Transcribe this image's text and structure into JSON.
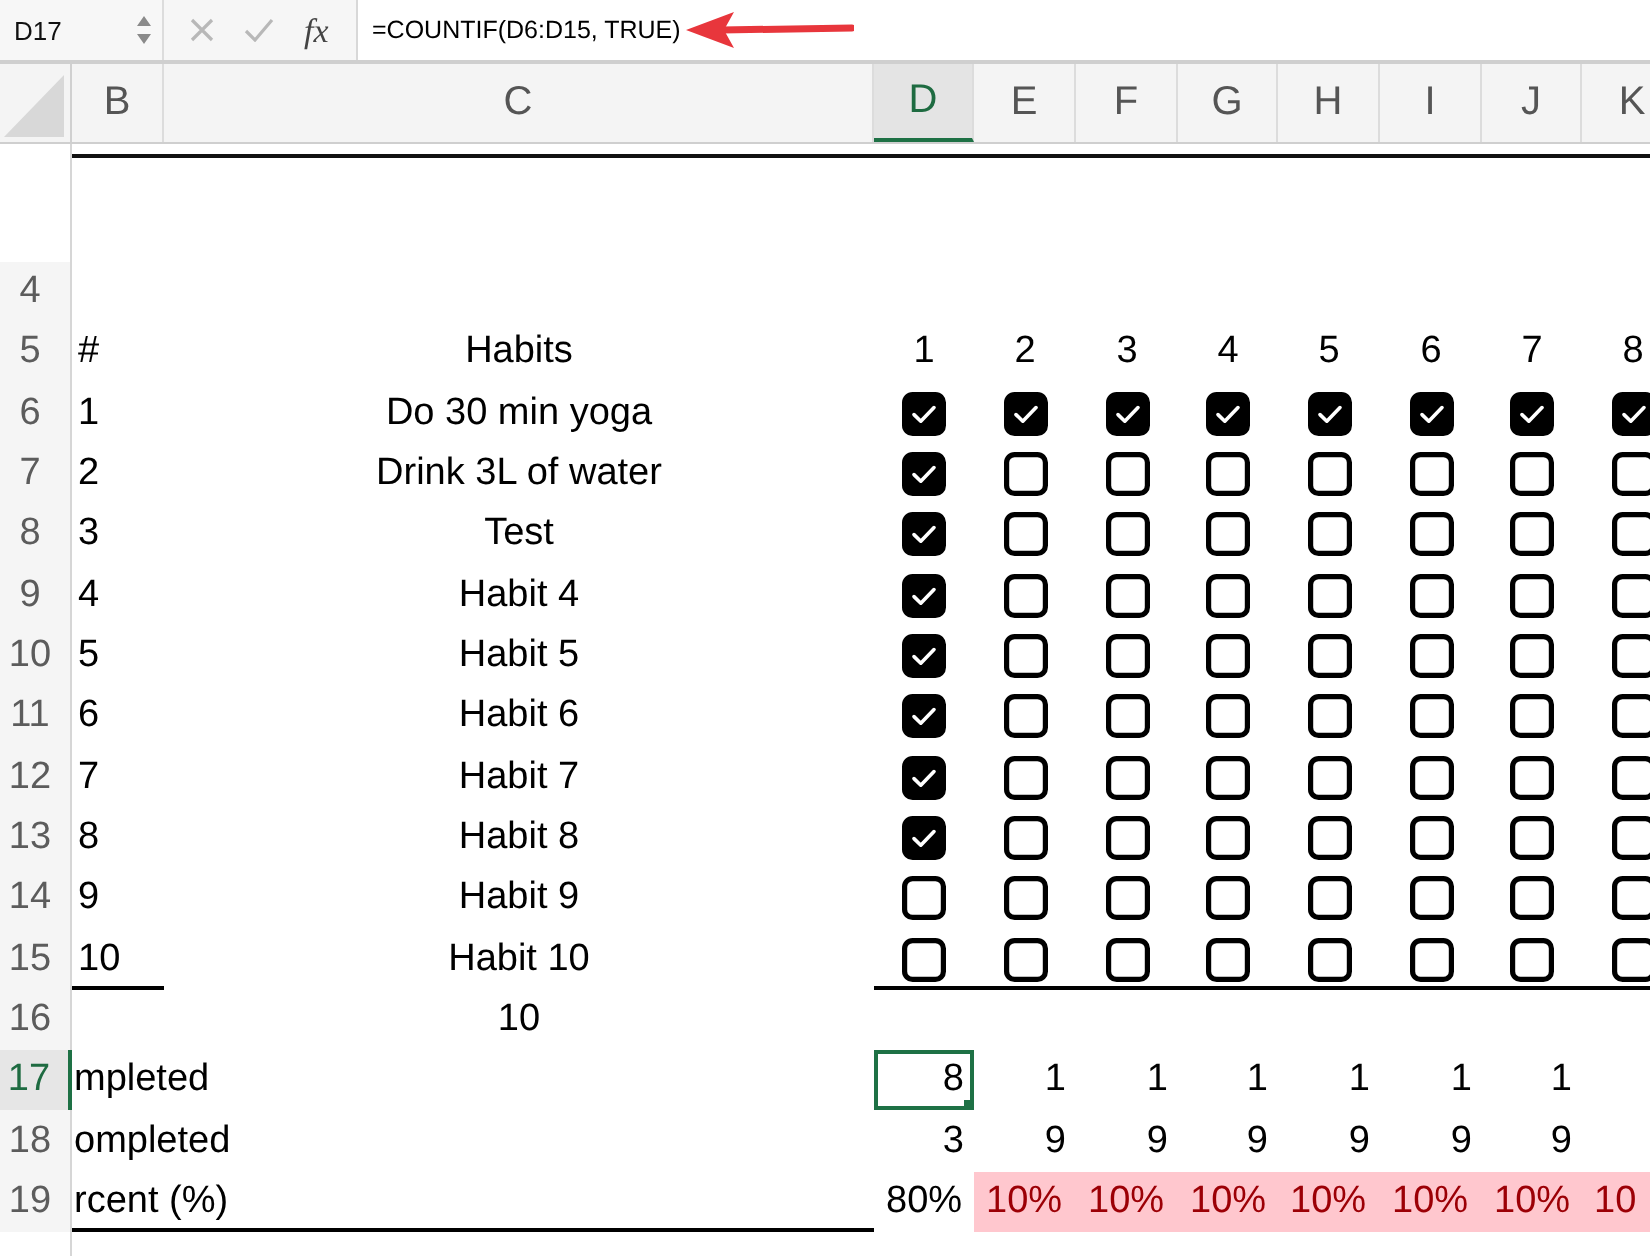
{
  "formula_bar": {
    "name_box": "D17",
    "function_label": "fx",
    "formula": "=COUNTIF(D6:D15, TRUE)"
  },
  "columns": [
    {
      "label": "B",
      "selected": false
    },
    {
      "label": "C",
      "selected": false
    },
    {
      "label": "D",
      "selected": true
    },
    {
      "label": "E",
      "selected": false
    },
    {
      "label": "F",
      "selected": false
    },
    {
      "label": "G",
      "selected": false
    },
    {
      "label": "H",
      "selected": false
    },
    {
      "label": "I",
      "selected": false
    },
    {
      "label": "J",
      "selected": false
    },
    {
      "label": "K",
      "selected": false
    }
  ],
  "rows": [
    {
      "kind": "blank",
      "number": "4",
      "selected": false
    },
    {
      "kind": "heading",
      "number": "5",
      "selected": false,
      "index": "#",
      "title": "Habits",
      "days": [
        "1",
        "2",
        "3",
        "4",
        "5",
        "6",
        "7",
        "8"
      ]
    },
    {
      "kind": "habit",
      "number": "6",
      "selected": false,
      "index": "1",
      "name": "Do 30 min yoga",
      "checks": [
        true,
        true,
        true,
        true,
        true,
        true,
        true,
        true
      ]
    },
    {
      "kind": "habit",
      "number": "7",
      "selected": false,
      "index": "2",
      "name": "Drink 3L of water",
      "checks": [
        true,
        false,
        false,
        false,
        false,
        false,
        false,
        false
      ]
    },
    {
      "kind": "habit",
      "number": "8",
      "selected": false,
      "index": "3",
      "name": "Test",
      "checks": [
        true,
        false,
        false,
        false,
        false,
        false,
        false,
        false
      ]
    },
    {
      "kind": "habit",
      "number": "9",
      "selected": false,
      "index": "4",
      "name": "Habit 4",
      "checks": [
        true,
        false,
        false,
        false,
        false,
        false,
        false,
        false
      ]
    },
    {
      "kind": "habit",
      "number": "10",
      "selected": false,
      "index": "5",
      "name": "Habit 5",
      "checks": [
        true,
        false,
        false,
        false,
        false,
        false,
        false,
        false
      ]
    },
    {
      "kind": "habit",
      "number": "11",
      "selected": false,
      "index": "6",
      "name": "Habit 6",
      "checks": [
        true,
        false,
        false,
        false,
        false,
        false,
        false,
        false
      ]
    },
    {
      "kind": "habit",
      "number": "12",
      "selected": false,
      "index": "7",
      "name": "Habit 7",
      "checks": [
        true,
        false,
        false,
        false,
        false,
        false,
        false,
        false
      ]
    },
    {
      "kind": "habit",
      "number": "13",
      "selected": false,
      "index": "8",
      "name": "Habit 8",
      "checks": [
        true,
        false,
        false,
        false,
        false,
        false,
        false,
        false
      ]
    },
    {
      "kind": "habit",
      "number": "14",
      "selected": false,
      "index": "9",
      "name": "Habit 9",
      "checks": [
        false,
        false,
        false,
        false,
        false,
        false,
        false,
        false
      ]
    },
    {
      "kind": "habit",
      "number": "15",
      "selected": false,
      "index": "10",
      "name": "Habit 10",
      "checks": [
        false,
        false,
        false,
        false,
        false,
        false,
        false,
        false
      ]
    },
    {
      "kind": "total",
      "number": "16",
      "selected": false,
      "value": "10"
    },
    {
      "kind": "count",
      "number": "17",
      "selected": true,
      "label": "mpleted",
      "values": [
        {
          "text": "8",
          "selected": true,
          "highlighted": false
        },
        {
          "text": "1",
          "selected": false,
          "highlighted": false
        },
        {
          "text": "1",
          "selected": false,
          "highlighted": false
        },
        {
          "text": "1",
          "selected": false,
          "highlighted": false
        },
        {
          "text": "1",
          "selected": false,
          "highlighted": false
        },
        {
          "text": "1",
          "selected": false,
          "highlighted": false
        },
        {
          "text": "1",
          "selected": false,
          "highlighted": false
        }
      ]
    },
    {
      "kind": "count",
      "number": "18",
      "selected": false,
      "label": "ompleted",
      "values": [
        {
          "text": "3",
          "selected": false,
          "highlighted": false
        },
        {
          "text": "9",
          "selected": false,
          "highlighted": false
        },
        {
          "text": "9",
          "selected": false,
          "highlighted": false
        },
        {
          "text": "9",
          "selected": false,
          "highlighted": false
        },
        {
          "text": "9",
          "selected": false,
          "highlighted": false
        },
        {
          "text": "9",
          "selected": false,
          "highlighted": false
        },
        {
          "text": "9",
          "selected": false,
          "highlighted": false
        }
      ]
    },
    {
      "kind": "percent",
      "number": "19",
      "selected": false,
      "label": "rcent (%)",
      "values": [
        {
          "text": "80%",
          "selected": false,
          "highlighted": false
        },
        {
          "text": "10%",
          "selected": false,
          "highlighted": true
        },
        {
          "text": "10%",
          "selected": false,
          "highlighted": true
        },
        {
          "text": "10%",
          "selected": false,
          "highlighted": true
        },
        {
          "text": "10%",
          "selected": false,
          "highlighted": true
        },
        {
          "text": "10%",
          "selected": false,
          "highlighted": true
        },
        {
          "text": "10%",
          "selected": false,
          "highlighted": true
        },
        {
          "text": "10",
          "selected": false,
          "highlighted": true
        }
      ]
    }
  ]
}
